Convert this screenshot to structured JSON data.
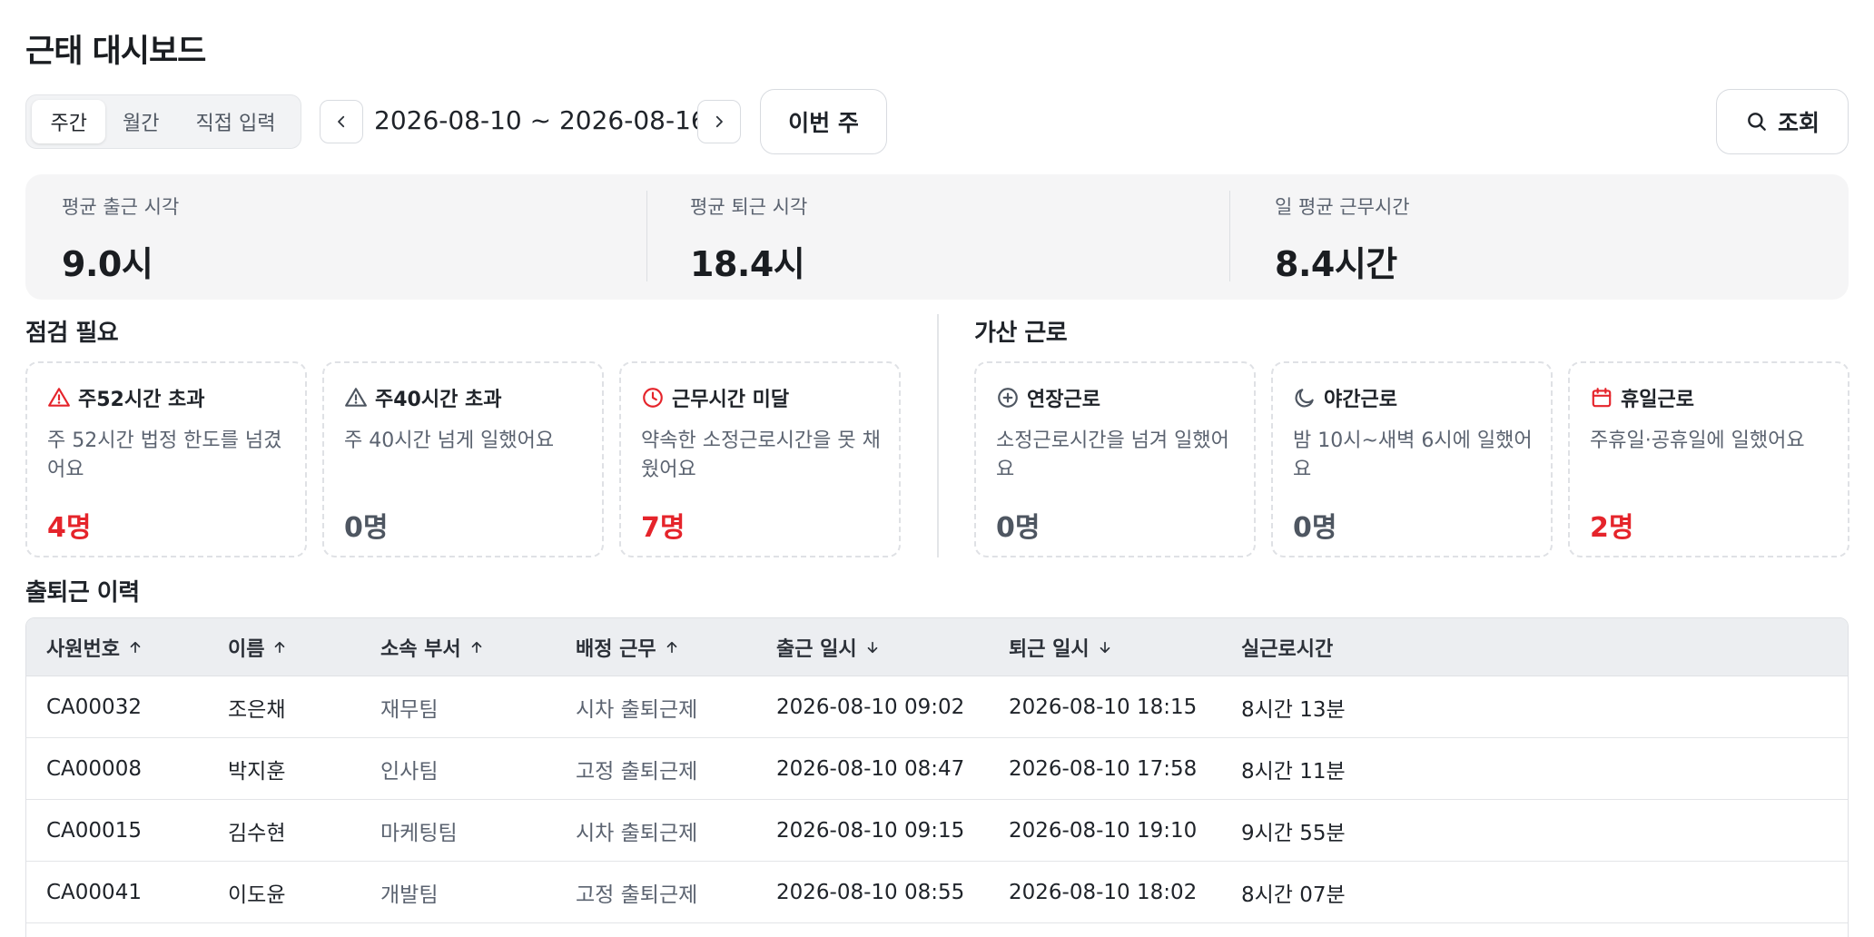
{
  "page_title": "근태 대시보드",
  "toolbar": {
    "period_tabs": [
      {
        "label": "주간",
        "active": true
      },
      {
        "label": "월간",
        "active": false
      },
      {
        "label": "직접 입력",
        "active": false
      }
    ],
    "date_range": "2026-08-10 ~ 2026-08-16",
    "this_week_label": "이번 주",
    "search_label": "조회"
  },
  "summary": [
    {
      "label": "평균 출근 시각",
      "value": "9.0시"
    },
    {
      "label": "평균 퇴근 시각",
      "value": "18.4시"
    },
    {
      "label": "일 평균 근무시간",
      "value": "8.4시간"
    }
  ],
  "check_needed": {
    "title": "점검 필요",
    "cards": [
      {
        "title": "주52시간 초과",
        "desc": "주 52시간 법정 한도를 넘겼어요",
        "count": "4명",
        "icon": "warning-icon",
        "icon_color": "#e5242b",
        "highlight": true
      },
      {
        "title": "주40시간 초과",
        "desc": "주 40시간 넘게 일했어요",
        "count": "0명",
        "icon": "warning-icon",
        "icon_color": "#4e5661",
        "highlight": false
      },
      {
        "title": "근무시간 미달",
        "desc": "약속한 소정근로시간을 못 채웠어요",
        "count": "7명",
        "icon": "clock-icon",
        "icon_color": "#e5242b",
        "highlight": true
      }
    ]
  },
  "extra_work": {
    "title": "가산 근로",
    "cards": [
      {
        "title": "연장근로",
        "desc": "소정근로시간을 넘겨 일했어요",
        "count": "0명",
        "icon": "plus-circle-icon",
        "icon_color": "#4e5661",
        "highlight": false
      },
      {
        "title": "야간근로",
        "desc": "밤 10시~새벽 6시에 일했어요",
        "count": "0명",
        "icon": "moon-icon",
        "icon_color": "#4e5661",
        "highlight": false
      },
      {
        "title": "휴일근로",
        "desc": "주휴일·공휴일에 일했어요",
        "count": "2명",
        "icon": "calendar-icon",
        "icon_color": "#e5242b",
        "highlight": true
      }
    ]
  },
  "history": {
    "title": "출퇴근 이력",
    "columns": [
      {
        "label": "사원번호",
        "sort": "up"
      },
      {
        "label": "이름",
        "sort": "up"
      },
      {
        "label": "소속 부서",
        "sort": "up"
      },
      {
        "label": "배정 근무",
        "sort": "up"
      },
      {
        "label": "출근 일시",
        "sort": "down"
      },
      {
        "label": "퇴근 일시",
        "sort": "down"
      },
      {
        "label": "실근로시간",
        "sort": ""
      }
    ],
    "rows": [
      [
        "CA00032",
        "조은채",
        "재무팀",
        "시차 출퇴근제",
        "2026-08-10 09:02",
        "2026-08-10 18:15",
        "8시간 13분"
      ],
      [
        "CA00008",
        "박지훈",
        "인사팀",
        "고정 출퇴근제",
        "2026-08-10 08:47",
        "2026-08-10 17:58",
        "8시간 11분"
      ],
      [
        "CA00015",
        "김수현",
        "마케팅팀",
        "시차 출퇴근제",
        "2026-08-10 09:15",
        "2026-08-10 19:10",
        "9시간 55분"
      ],
      [
        "CA00041",
        "이도윤",
        "개발팀",
        "고정 출퇴근제",
        "2026-08-10 08:55",
        "2026-08-10 18:02",
        "8시간 07분"
      ]
    ]
  }
}
